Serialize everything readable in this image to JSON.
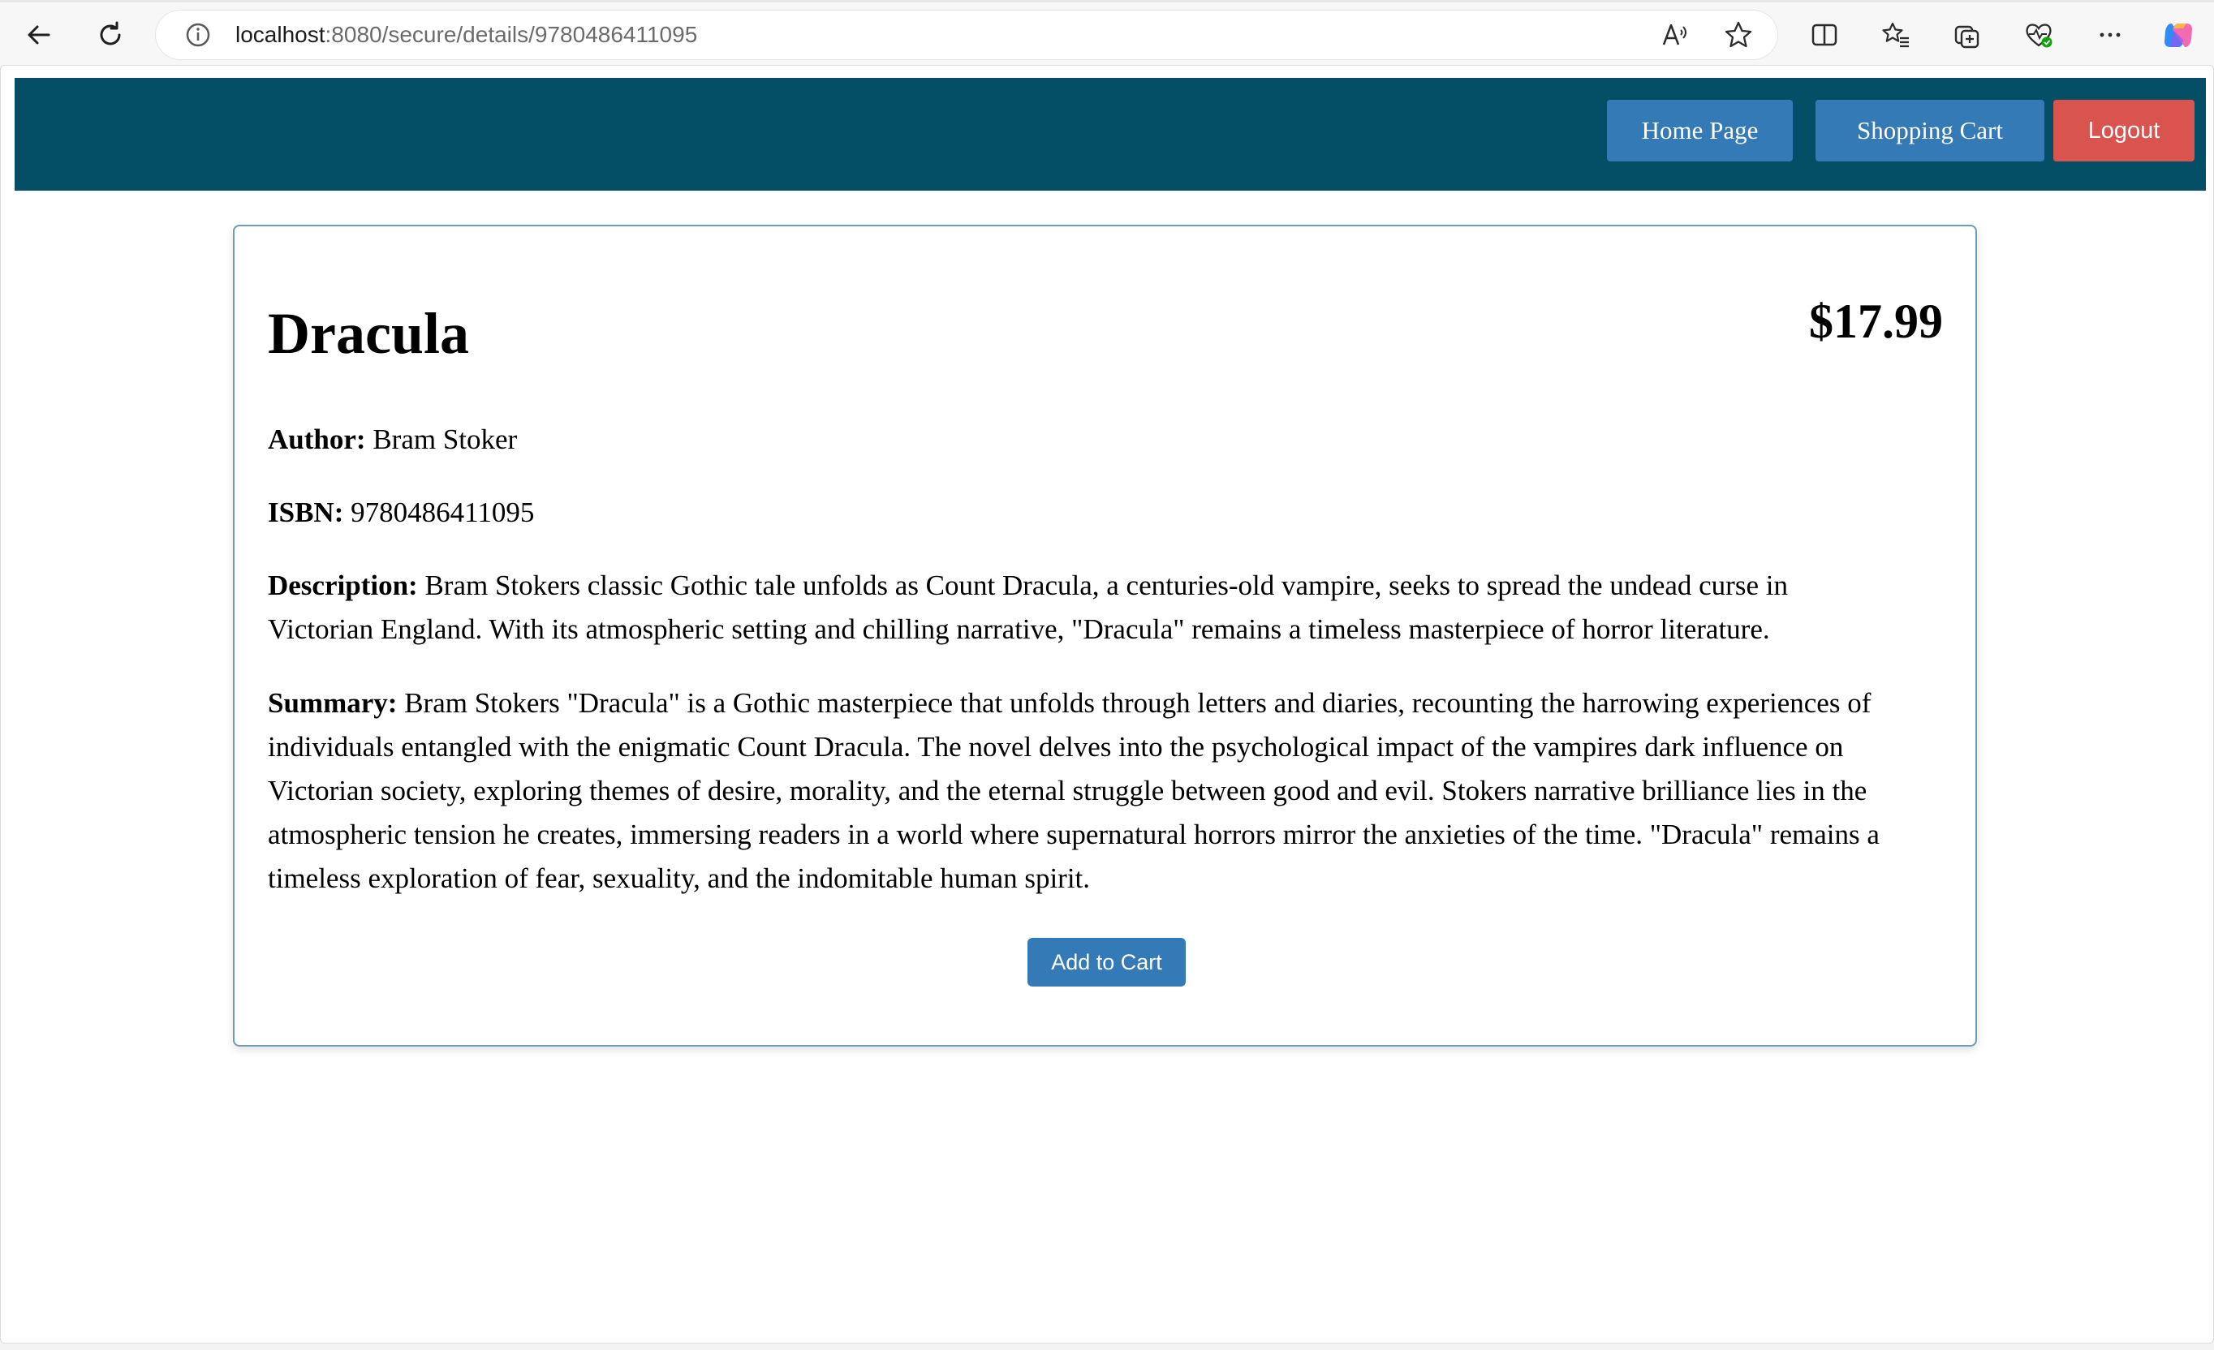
{
  "browser": {
    "url_host": "localhost",
    "url_path": ":8080/secure/details/9780486411095"
  },
  "navbar": {
    "home_label": "Home Page",
    "cart_label": "Shopping Cart",
    "logout_label": "Logout",
    "colors": {
      "bar": "#054f66",
      "primary": "#337ab7",
      "danger": "#d9534f"
    }
  },
  "book": {
    "title": "Dracula",
    "price": "$17.99",
    "author_label": "Author:",
    "author": "Bram Stoker",
    "isbn_label": "ISBN:",
    "isbn": "9780486411095",
    "description_label": "Description:",
    "description": "Bram Stokers classic Gothic tale unfolds as Count Dracula, a centuries-old vampire, seeks to spread the undead curse in Victorian England. With its atmospheric setting and chilling narrative, \"Dracula\" remains a timeless masterpiece of horror literature.",
    "summary_label": "Summary:",
    "summary": "Bram Stokers \"Dracula\" is a Gothic masterpiece that unfolds through letters and diaries, recounting the harrowing experiences of individuals entangled with the enigmatic Count Dracula. The novel delves into the psychological impact of the vampires dark influence on Victorian society, exploring themes of desire, morality, and the eternal struggle between good and evil. Stokers narrative brilliance lies in the atmospheric tension he creates, immersing readers in a world where supernatural horrors mirror the anxieties of the time. \"Dracula\" remains a timeless exploration of fear, sexuality, and the indomitable human spirit.",
    "add_to_cart_label": "Add to Cart"
  }
}
